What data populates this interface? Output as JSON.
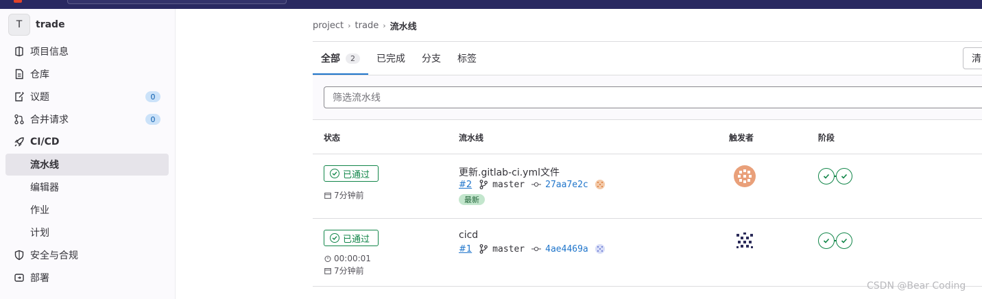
{
  "sidebar": {
    "project": {
      "avatar": "T",
      "name": "trade"
    },
    "items": [
      {
        "label": "项目信息",
        "icon": "info-icon"
      },
      {
        "label": "仓库",
        "icon": "document-icon"
      },
      {
        "label": "议题",
        "icon": "issues-icon",
        "count": "0"
      },
      {
        "label": "合并请求",
        "icon": "merge-request-icon",
        "count": "0"
      },
      {
        "label": "CI/CD",
        "icon": "rocket-icon"
      },
      {
        "label": "流水线"
      },
      {
        "label": "编辑器"
      },
      {
        "label": "作业"
      },
      {
        "label": "计划"
      },
      {
        "label": "安全与合规",
        "icon": "shield-icon"
      },
      {
        "label": "部署",
        "icon": "deployments-icon"
      }
    ]
  },
  "breadcrumb": {
    "items": [
      "project",
      "trade"
    ],
    "current": "流水线"
  },
  "tabs": [
    {
      "label": "全部",
      "count": "2"
    },
    {
      "label": "已完成"
    },
    {
      "label": "分支"
    },
    {
      "label": "标签"
    }
  ],
  "toolbar": {
    "clear_label": "清"
  },
  "filter": {
    "placeholder": "筛选流水线"
  },
  "table": {
    "headers": {
      "status": "状态",
      "pipeline": "流水线",
      "trigger": "触发者",
      "stages": "阶段"
    },
    "rows": [
      {
        "status": "已通过",
        "time_ago": "7分钟前",
        "title": "更新.gitlab-ci.yml文件",
        "id": "#2",
        "branch": "master",
        "sha": "27aa7e2c",
        "latest": "最新"
      },
      {
        "status": "已通过",
        "duration": "00:00:01",
        "time_ago": "7分钟前",
        "title": "cicd",
        "id": "#1",
        "branch": "master",
        "sha": "4ae4469a"
      }
    ]
  },
  "watermark": "CSDN @Bear Coding",
  "colors": {
    "success": "#108548",
    "link": "#1f75cb",
    "navbar": "#292961"
  }
}
